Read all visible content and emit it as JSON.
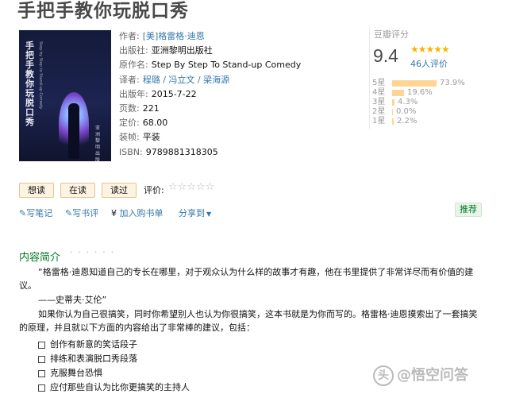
{
  "book": {
    "title": "手把手教你玩脱口秀",
    "cover": {
      "title_text": "手把手教你玩脱口秀",
      "subtitle_text": "Step by Step to Stand-up Comedy",
      "publisher_text": "亚洲黎明出版社"
    },
    "info": [
      {
        "key": "作者:",
        "value": "[美]格雷格·迪恩",
        "link": true
      },
      {
        "key": "出版社:",
        "value": "亚洲黎明出版社",
        "link": false
      },
      {
        "key": "原作名:",
        "value": "Step By Step To Stand-up Comedy",
        "link": false
      },
      {
        "key": "译者:",
        "value": "程璐 / 冯立文 / 梁海源",
        "link": true
      },
      {
        "key": "出版年:",
        "value": "2015-7-22",
        "link": false
      },
      {
        "key": "页数:",
        "value": "221",
        "link": false
      },
      {
        "key": "定价:",
        "value": "68.00",
        "link": false
      },
      {
        "key": "装帧:",
        "value": "平装",
        "link": false
      },
      {
        "key": "ISBN:",
        "value": "9789881318305",
        "link": false
      }
    ]
  },
  "rating": {
    "title": "豆瓣评分",
    "score": "9.4",
    "stars": "★★★★★",
    "count": "46人评价",
    "rows": [
      {
        "label": "5星",
        "pct": "73.9%",
        "value": 73.9
      },
      {
        "label": "4星",
        "pct": "19.6%",
        "value": 19.6
      },
      {
        "label": "3星",
        "pct": "4.3%",
        "value": 4.3
      },
      {
        "label": "2星",
        "pct": "0.0%",
        "value": 0.0
      },
      {
        "label": "1星",
        "pct": "2.2%",
        "value": 2.2
      }
    ]
  },
  "actions": {
    "want_read": "想读",
    "reading": "在读",
    "read": "读过",
    "rate_label": "评价:",
    "rate_stars": "☆☆☆☆☆",
    "write_note": "写笔记",
    "write_review": "写书评",
    "add_list": "加入购书单",
    "share": "分享到",
    "share_arrow": "▼",
    "recommend": "推荐",
    "yen": "¥"
  },
  "intro": {
    "heading": "内容简介",
    "dots": "· · · · · ·",
    "quote": "“格雷格·迪恩知道自己的专长在哪里，对于观众认为什么样的故事才有趣，他在书里提供了非常详尽而有价值的建议。",
    "quote_author": "——史蒂夫·艾伦”",
    "body": "如果你认为自己很搞笑，同时你希望别人也认为你很搞笑，这本书就是为你而写的。格雷格·迪恩摸索出了一套搞笑的原理，并且就以下方面的内容给出了非常棒的建议，包括：",
    "items": [
      "创作有新意的笑话段子",
      "排练和表演脱口秀段落",
      "克服舞台恐惧",
      "应付那些自认为比你更搞笑的主持人"
    ]
  },
  "watermark": {
    "icon": "头",
    "text": "@悟空问答"
  }
}
